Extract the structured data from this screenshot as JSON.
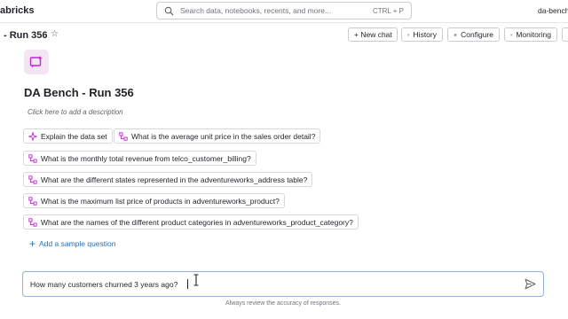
{
  "topbar": {
    "brand": "abricks",
    "search_placeholder": "Search data, notebooks, recents, and more...",
    "search_shortcut": "CTRL + P",
    "workspace": "da-bench"
  },
  "header": {
    "title": "- Run 356",
    "buttons": {
      "new_chat": "+ New chat",
      "history": "History",
      "configure": "Configure",
      "monitoring": "Monitoring"
    }
  },
  "space": {
    "title": "DA Bench - Run 356",
    "description_placeholder": "Click here to add a description"
  },
  "sample_questions": [
    "Explain the data set",
    "What is the average unit price in the sales order detail?",
    "What is the monthly total revenue from telco_customer_billing?",
    "What are the different states represented in the adventureworks_address table?",
    "What is the maximum list price of products in adventureworks_product?",
    "What are the names of the different product categories in adventureworks_product_category?"
  ],
  "add_sample_label": "Add a sample question",
  "chat": {
    "input_value": "How many customers churned 3 years ago?",
    "disclaimer": "Always review the accuracy of responses."
  },
  "colors": {
    "accent": "#2272b4",
    "logo_bg": "#f3e6f3",
    "logo_fg": "#c026d3"
  }
}
